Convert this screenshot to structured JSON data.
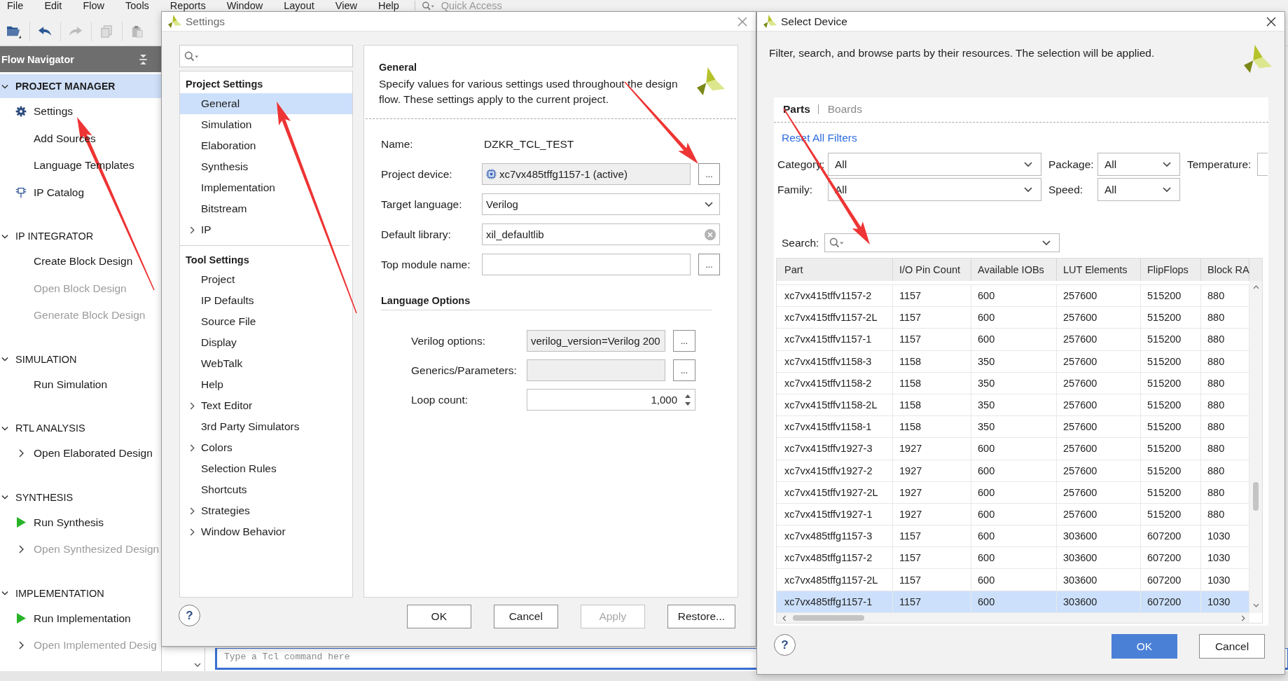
{
  "menu_bar": {
    "items": [
      "File",
      "Edit",
      "Flow",
      "Tools",
      "Reports",
      "Window",
      "Layout",
      "View",
      "Help"
    ],
    "quick_access": {
      "placeholder": "Quick Access"
    }
  },
  "toolbar": [
    {
      "kind": "open",
      "disabled": false
    },
    {
      "kind": "undo",
      "disabled": false
    },
    {
      "kind": "redo",
      "disabled": true
    },
    {
      "kind": "copy",
      "disabled": true
    },
    {
      "kind": "paste",
      "disabled": true
    }
  ],
  "flow_navigator": {
    "title": "Flow Navigator",
    "sections": [
      {
        "label": "PROJECT MANAGER",
        "expanded": true,
        "selected": true,
        "items": [
          {
            "label": "Settings",
            "kind": "gear",
            "disabled": false
          },
          {
            "label": "Add Sources",
            "kind": "plain",
            "disabled": false
          },
          {
            "label": "Language Templates",
            "kind": "plain",
            "disabled": false
          },
          {
            "label": "IP Catalog",
            "kind": "catalog",
            "disabled": false
          }
        ]
      },
      {
        "label": "IP INTEGRATOR",
        "expanded": true,
        "selected": false,
        "items": [
          {
            "label": "Create Block Design",
            "kind": "plain",
            "disabled": false
          },
          {
            "label": "Open Block Design",
            "kind": "plain",
            "disabled": true
          },
          {
            "label": "Generate Block Design",
            "kind": "plain",
            "disabled": true
          }
        ]
      },
      {
        "label": "SIMULATION",
        "expanded": true,
        "selected": false,
        "items": [
          {
            "label": "Run Simulation",
            "kind": "plain",
            "disabled": false
          }
        ]
      },
      {
        "label": "RTL ANALYSIS",
        "expanded": true,
        "selected": false,
        "items": [
          {
            "label": "Open Elaborated Design",
            "kind": "expandable",
            "disabled": false
          }
        ]
      },
      {
        "label": "SYNTHESIS",
        "expanded": true,
        "selected": false,
        "items": [
          {
            "label": "Run Synthesis",
            "kind": "run",
            "disabled": false
          },
          {
            "label": "Open Synthesized Design",
            "kind": "expandable",
            "disabled": true
          }
        ]
      },
      {
        "label": "IMPLEMENTATION",
        "expanded": true,
        "selected": false,
        "items": [
          {
            "label": "Run Implementation",
            "kind": "run",
            "disabled": false
          },
          {
            "label": "Open Implemented Desig",
            "kind": "expandable",
            "disabled": true
          }
        ]
      }
    ]
  },
  "tcl_console": {
    "placeholder": "Type a Tcl command here"
  },
  "settings_dialog": {
    "title": "Settings",
    "active": false,
    "tree": [
      {
        "label": "Project Settings",
        "children": [
          {
            "label": "General",
            "kind": "leaf",
            "selected": true
          },
          {
            "label": "Simulation",
            "kind": "leaf",
            "selected": false
          },
          {
            "label": "Elaboration",
            "kind": "leaf",
            "selected": false
          },
          {
            "label": "Synthesis",
            "kind": "leaf",
            "selected": false
          },
          {
            "label": "Implementation",
            "kind": "leaf",
            "selected": false
          },
          {
            "label": "Bitstream",
            "kind": "leaf",
            "selected": false
          },
          {
            "label": "IP",
            "kind": "folder",
            "selected": false
          }
        ]
      },
      {
        "label": "Tool Settings",
        "children": [
          {
            "label": "Project",
            "kind": "leaf",
            "selected": false
          },
          {
            "label": "IP Defaults",
            "kind": "leaf",
            "selected": false
          },
          {
            "label": "Source File",
            "kind": "leaf",
            "selected": false
          },
          {
            "label": "Display",
            "kind": "leaf",
            "selected": false
          },
          {
            "label": "WebTalk",
            "kind": "leaf",
            "selected": false
          },
          {
            "label": "Help",
            "kind": "leaf",
            "selected": false
          },
          {
            "label": "Text Editor",
            "kind": "folder",
            "selected": false
          },
          {
            "label": "3rd Party Simulators",
            "kind": "leaf",
            "selected": false
          },
          {
            "label": "Colors",
            "kind": "folder",
            "selected": false
          },
          {
            "label": "Selection Rules",
            "kind": "leaf",
            "selected": false
          },
          {
            "label": "Shortcuts",
            "kind": "leaf",
            "selected": false
          },
          {
            "label": "Strategies",
            "kind": "folder",
            "selected": false
          },
          {
            "label": "Window Behavior",
            "kind": "folder",
            "selected": false
          }
        ]
      }
    ],
    "panel": {
      "title": "General",
      "description": "Specify values for various settings used throughout the design flow. These settings apply to the current project.",
      "fields": [
        {
          "kind": "static",
          "label": "Name:",
          "value": "DZKR_TCL_TEST"
        },
        {
          "kind": "device",
          "label": "Project device:",
          "value": "xc7vx485tffg1157-1 (active)",
          "button": "..."
        },
        {
          "kind": "dropdown",
          "label": "Target language:",
          "value": "Verilog"
        },
        {
          "kind": "clearable",
          "label": "Default library:",
          "value": "xil_defaultlib"
        },
        {
          "kind": "browse",
          "label": "Top module name:",
          "button": "..."
        }
      ],
      "language_options": {
        "title": "Language Options",
        "fields": [
          {
            "kind": "options",
            "label": "Verilog options:",
            "value": "verilog_version=Verilog 200",
            "button": "..."
          },
          {
            "kind": "options",
            "label": "Generics/Parameters:",
            "button": "..."
          },
          {
            "kind": "spinner",
            "label": "Loop count:",
            "value": "1,000"
          }
        ]
      }
    },
    "help": "?",
    "buttons": [
      {
        "label": "OK",
        "disabled": false
      },
      {
        "label": "Cancel",
        "disabled": false
      },
      {
        "label": "Apply",
        "disabled": true
      },
      {
        "label": "Restore...",
        "disabled": false
      }
    ]
  },
  "select_device_dialog": {
    "title": "Select Device",
    "active": true,
    "description": "Filter, search, and browse parts by their resources. The selection will be applied.",
    "tabs": [
      {
        "label": "Parts",
        "selected": true
      },
      {
        "label": "Boards",
        "selected": false
      }
    ],
    "reset_link": "Reset All Filters",
    "filter_rows": [
      [
        {
          "label": "Category:",
          "value": "All"
        },
        {
          "label": "Package:",
          "value": "All"
        },
        {
          "label": "Temperature:"
        }
      ],
      [
        {
          "label": "Family:",
          "value": "All"
        },
        {
          "label": "Speed:",
          "value": "All"
        }
      ]
    ],
    "search": {
      "label": "Search:"
    },
    "table": {
      "columns": [
        "Part",
        "I/O Pin Count",
        "Available IOBs",
        "LUT Elements",
        "FlipFlops",
        "Block RA"
      ],
      "rows": [
        {
          "cells": [
            "xc7vx415tffv1157-2",
            "1157",
            "600",
            "257600",
            "515200",
            "880"
          ],
          "selected": false
        },
        {
          "cells": [
            "xc7vx415tffv1157-2L",
            "1157",
            "600",
            "257600",
            "515200",
            "880"
          ],
          "selected": false
        },
        {
          "cells": [
            "xc7vx415tffv1157-1",
            "1157",
            "600",
            "257600",
            "515200",
            "880"
          ],
          "selected": false
        },
        {
          "cells": [
            "xc7vx415tffv1158-3",
            "1158",
            "350",
            "257600",
            "515200",
            "880"
          ],
          "selected": false
        },
        {
          "cells": [
            "xc7vx415tffv1158-2",
            "1158",
            "350",
            "257600",
            "515200",
            "880"
          ],
          "selected": false
        },
        {
          "cells": [
            "xc7vx415tffv1158-2L",
            "1158",
            "350",
            "257600",
            "515200",
            "880"
          ],
          "selected": false
        },
        {
          "cells": [
            "xc7vx415tffv1158-1",
            "1158",
            "350",
            "257600",
            "515200",
            "880"
          ],
          "selected": false
        },
        {
          "cells": [
            "xc7vx415tffv1927-3",
            "1927",
            "600",
            "257600",
            "515200",
            "880"
          ],
          "selected": false
        },
        {
          "cells": [
            "xc7vx415tffv1927-2",
            "1927",
            "600",
            "257600",
            "515200",
            "880"
          ],
          "selected": false
        },
        {
          "cells": [
            "xc7vx415tffv1927-2L",
            "1927",
            "600",
            "257600",
            "515200",
            "880"
          ],
          "selected": false
        },
        {
          "cells": [
            "xc7vx415tffv1927-1",
            "1927",
            "600",
            "257600",
            "515200",
            "880"
          ],
          "selected": false
        },
        {
          "cells": [
            "xc7vx485tffg1157-3",
            "1157",
            "600",
            "303600",
            "607200",
            "1030"
          ],
          "selected": false
        },
        {
          "cells": [
            "xc7vx485tffg1157-2",
            "1157",
            "600",
            "303600",
            "607200",
            "1030"
          ],
          "selected": false
        },
        {
          "cells": [
            "xc7vx485tffg1157-2L",
            "1157",
            "600",
            "303600",
            "607200",
            "1030"
          ],
          "selected": false
        },
        {
          "cells": [
            "xc7vx485tffg1157-1",
            "1157",
            "600",
            "303600",
            "607200",
            "1030"
          ],
          "selected": true
        }
      ]
    },
    "help": "?",
    "buttons": [
      {
        "label": "OK",
        "kind": "primary"
      },
      {
        "label": "Cancel",
        "kind": "normal"
      }
    ]
  }
}
